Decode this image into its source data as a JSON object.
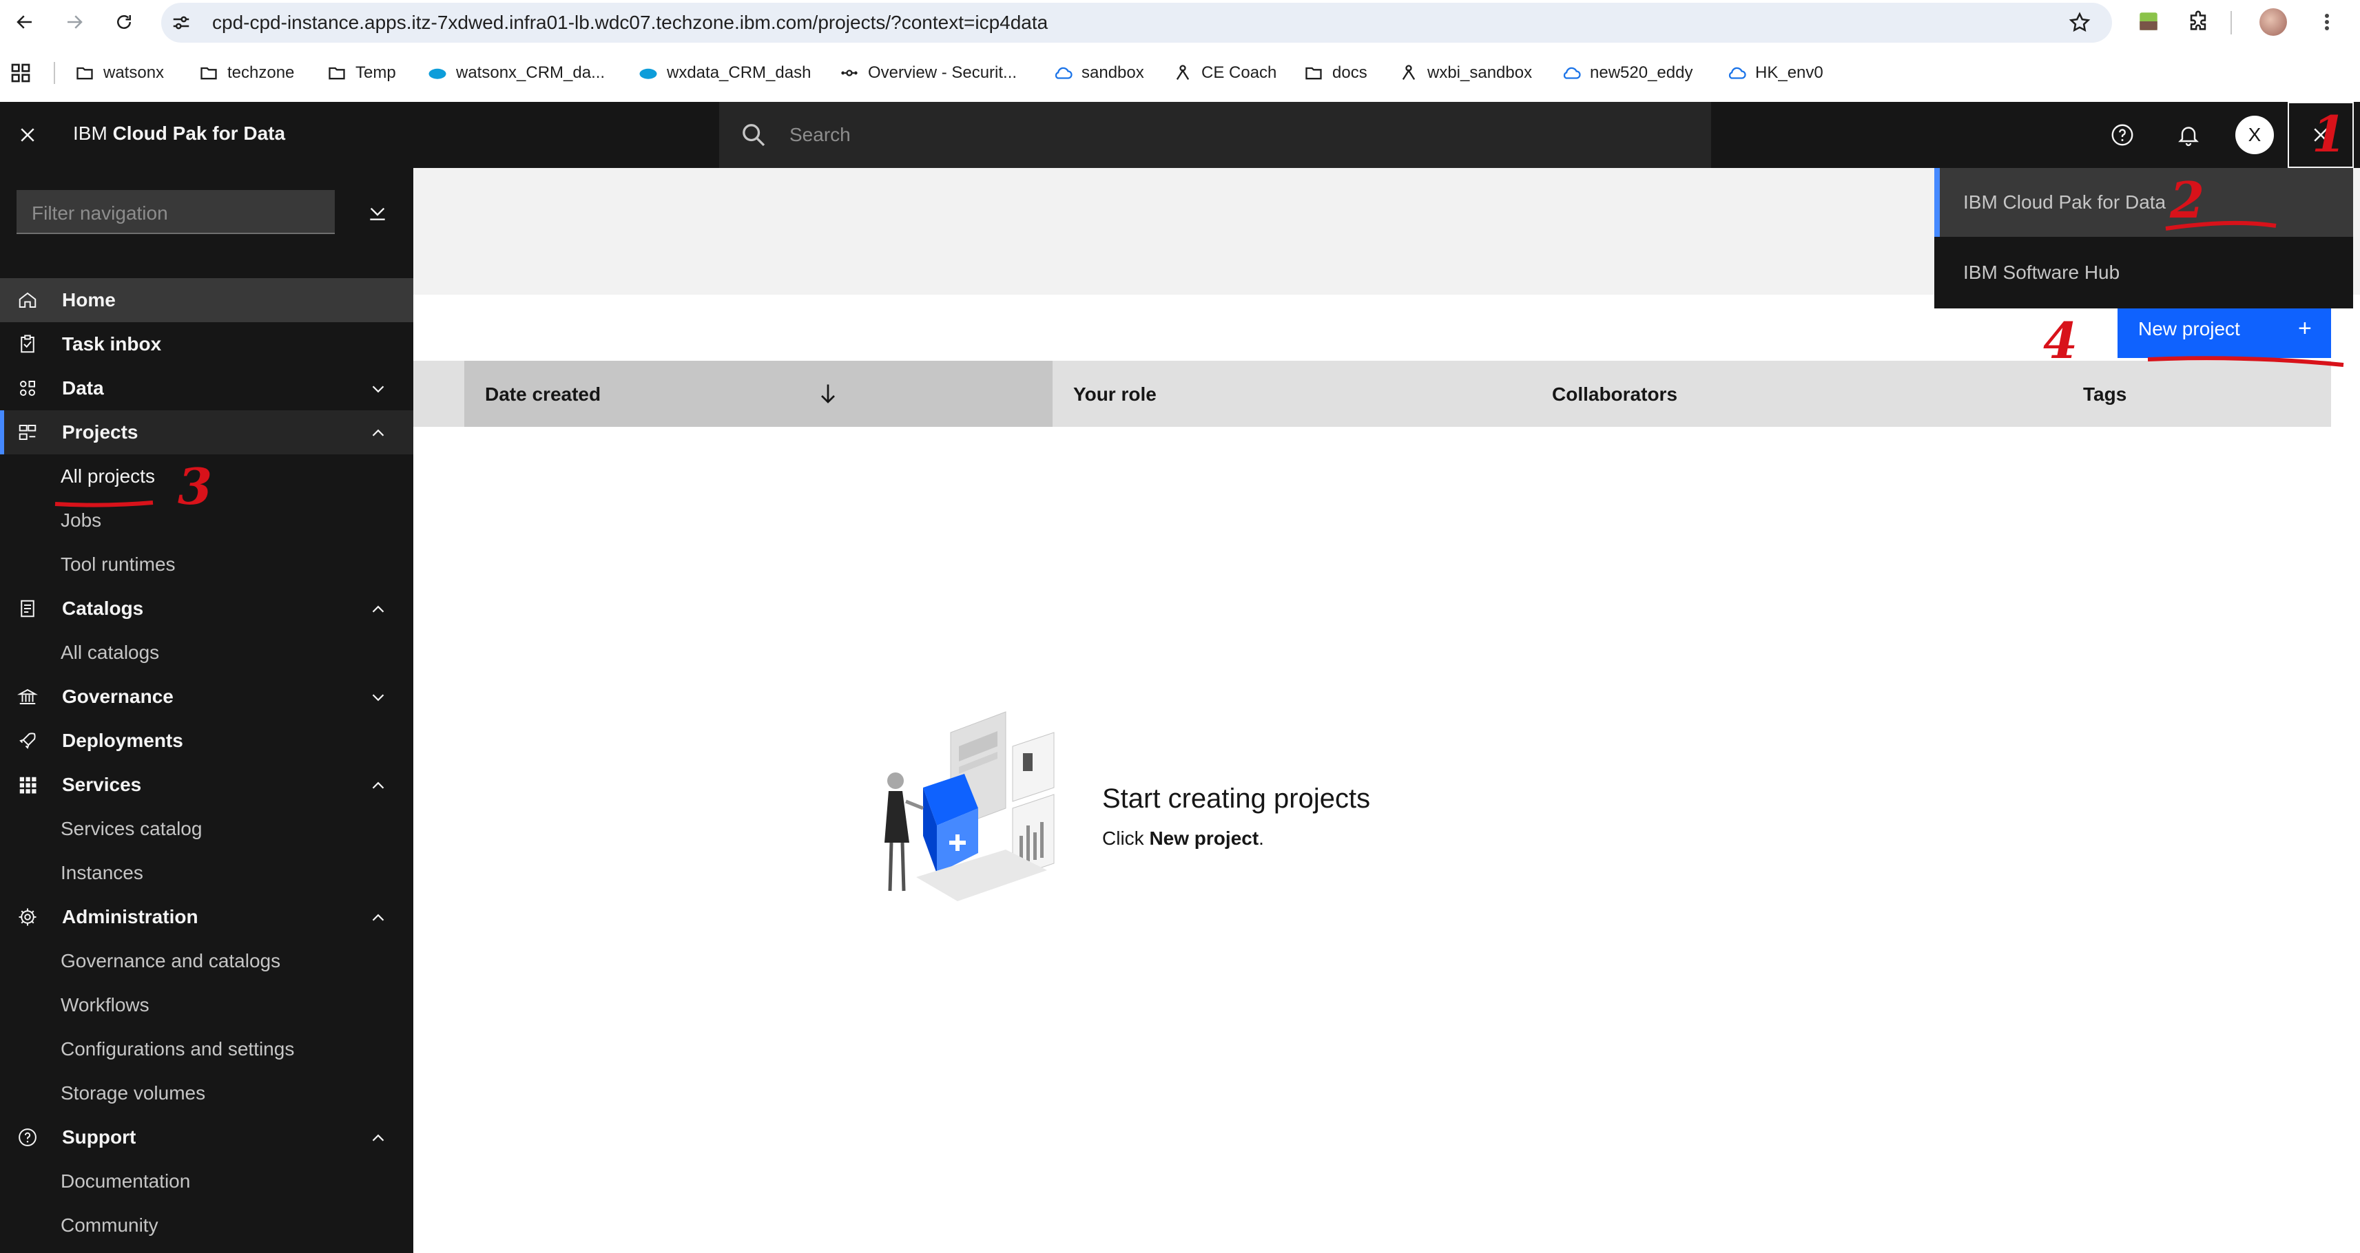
{
  "browser": {
    "url": "cpd-cpd-instance.apps.itz-7xdwed.infra01-lb.wdc07.techzone.ibm.com/projects/?context=icp4data",
    "bookmarks": [
      {
        "label": "watsonx",
        "icon": "folder-icon"
      },
      {
        "label": "techzone",
        "icon": "folder-icon"
      },
      {
        "label": "Temp",
        "icon": "folder-icon"
      },
      {
        "label": "watsonx_CRM_da...",
        "icon": "salesforce-cloud-icon"
      },
      {
        "label": "wxdata_CRM_dash",
        "icon": "salesforce-cloud-icon"
      },
      {
        "label": "Overview - Securit...",
        "icon": "network-icon"
      },
      {
        "label": "sandbox",
        "icon": "cloud-icon"
      },
      {
        "label": "CE Coach",
        "icon": "network-icon"
      },
      {
        "label": "docs",
        "icon": "folder-icon"
      },
      {
        "label": "wxbi_sandbox",
        "icon": "network-icon"
      },
      {
        "label": "new520_eddy",
        "icon": "cloud-icon"
      },
      {
        "label": "HK_env0",
        "icon": "cloud-icon"
      }
    ]
  },
  "header": {
    "brand_prefix": "IBM",
    "brand_name": "Cloud Pak for Data",
    "search_placeholder": "Search",
    "user_initial": "X"
  },
  "sidebar": {
    "filter_placeholder": "Filter navigation",
    "items": {
      "home": "Home",
      "task_inbox": "Task inbox",
      "data": "Data",
      "projects": "Projects",
      "all_projects": "All projects",
      "jobs": "Jobs",
      "tool_runtimes": "Tool runtimes",
      "catalogs": "Catalogs",
      "all_catalogs": "All catalogs",
      "governance": "Governance",
      "deployments": "Deployments",
      "services": "Services",
      "services_catalog": "Services catalog",
      "instances": "Instances",
      "administration": "Administration",
      "governance_and_catalogs": "Governance and catalogs",
      "workflows": "Workflows",
      "configurations_and_settings": "Configurations and settings",
      "storage_volumes": "Storage volumes",
      "support": "Support",
      "documentation": "Documentation",
      "community": "Community"
    }
  },
  "switcher": {
    "items": [
      "IBM Cloud Pak for Data",
      "IBM Software Hub"
    ]
  },
  "main": {
    "new_project_label": "New project",
    "new_project_icon": "+",
    "columns": {
      "date_created": "Date created",
      "your_role": "Your role",
      "collaborators": "Collaborators",
      "tags": "Tags"
    },
    "empty_title": "Start creating projects",
    "empty_desc_prefix": "Click",
    "empty_desc_bold": "New project",
    "empty_desc_suffix": "."
  },
  "annotations": [
    "1",
    "2",
    "3",
    "4"
  ],
  "colors": {
    "header_bg": "#161616",
    "primary_button": "#0f62fe",
    "annotation_red": "#d8121a",
    "active_indicator": "#4589ff"
  }
}
